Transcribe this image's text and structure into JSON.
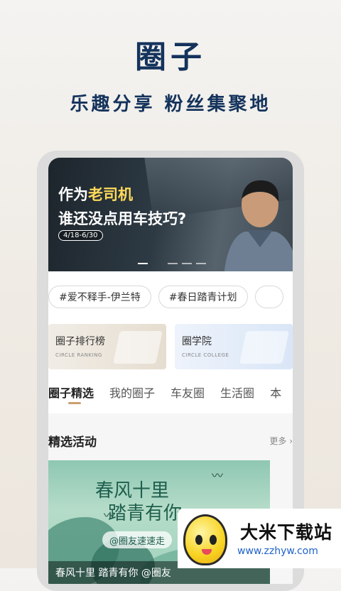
{
  "hero": {
    "title": "圈子",
    "subtitle": "乐趣分享 粉丝集聚地"
  },
  "banner": {
    "line1_a": "作为",
    "line1_b": "老司机",
    "line2": "谁还没点用车技巧?",
    "date": "4/18-6/30",
    "slide_count": 4,
    "active_slide": 1
  },
  "tags": [
    "#爱不释手-伊兰特",
    "#春日踏青计划"
  ],
  "cards": {
    "rank": {
      "title": "圈子排行榜",
      "subtitle": "CIRCLE RANKING"
    },
    "college": {
      "title": "圈学院",
      "subtitle": "CIRCLE COLLEGE"
    }
  },
  "tabs": [
    "圈子精选",
    "我的圈子",
    "车友圈",
    "生活圈",
    "本"
  ],
  "section": {
    "title": "精选活动",
    "more": "更多 ›"
  },
  "activity": {
    "title_line1": "春风十里",
    "title_line2": "踏青有你",
    "pill": "@圈友速速走",
    "caption": "春风十里 踏青有你 @圈友"
  },
  "watermark": {
    "name": "大米下载站",
    "url": "www.zzhyw.com"
  },
  "colors": {
    "brand_navy": "#14335c",
    "tab_accent": "#c9a070",
    "banner_highlight": "#ffd95a"
  }
}
